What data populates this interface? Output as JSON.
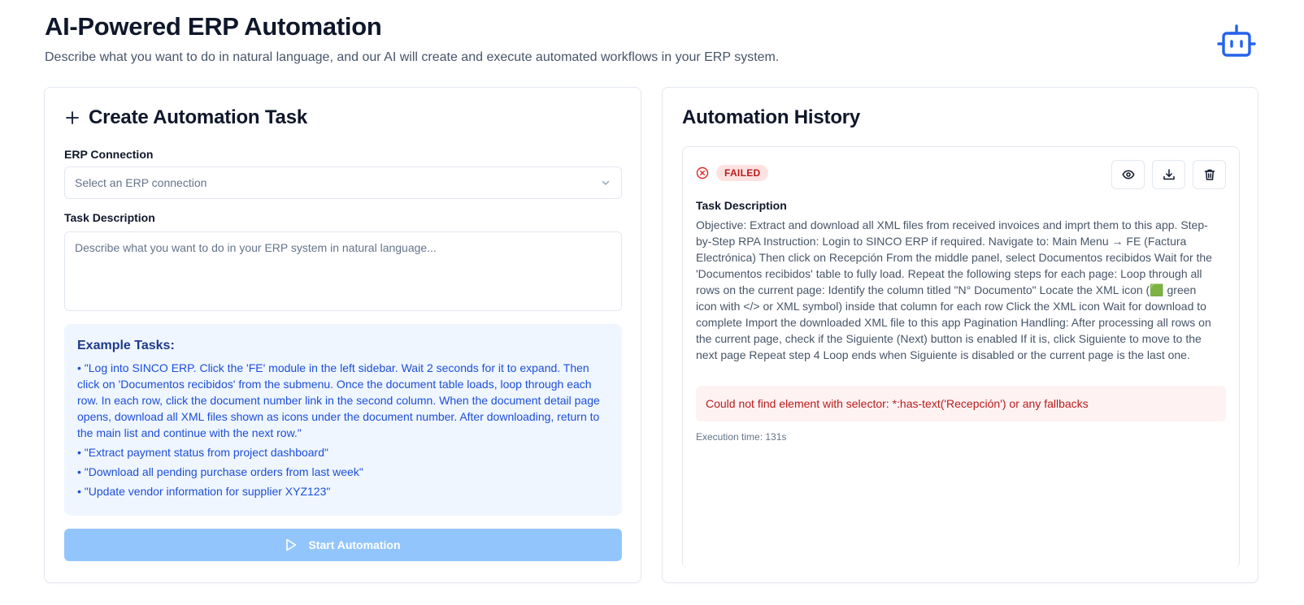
{
  "header": {
    "title": "AI-Powered ERP Automation",
    "subtitle": "Describe what you want to do in natural language, and our AI will create and execute automated workflows in your ERP system."
  },
  "create_task": {
    "title": "Create Automation Task",
    "erp_label": "ERP Connection",
    "erp_placeholder": "Select an ERP connection",
    "task_label": "Task Description",
    "task_placeholder": "Describe what you want to do in your ERP system in natural language...",
    "examples_title": "Example Tasks:",
    "examples": [
      "• \"Log into SINCO ERP. Click the 'FE' module in the left sidebar. Wait 2 seconds for it to expand. Then click on 'Documentos recibidos' from the submenu. Once the document table loads, loop through each row. In each row, click the document number link in the second column. When the document detail page opens, download all XML files shown as icons under the document number. After downloading, return to the main list and continue with the next row.\"",
      "• \"Extract payment status from project dashboard\"",
      "• \"Download all pending purchase orders from last week\"",
      "• \"Update vendor information for supplier XYZ123\""
    ],
    "start_button": "Start Automation"
  },
  "history": {
    "title": "Automation History",
    "items": [
      {
        "status": "FAILED",
        "task_label": "Task Description",
        "task_text": "Objective: Extract and download all XML files from received invoices and imprt them to this app. Step-by-Step RPA Instruction: Login to SINCO ERP if required. Navigate to: Main Menu → FE (Factura Electrónica) Then click on Recepción From the middle panel, select Documentos recibidos Wait for the 'Documentos recibidos' table to fully load. Repeat the following steps for each page: Loop through all rows on the current page: Identify the column titled \"N° Documento\" Locate the XML icon (🟩 green icon with </> or XML symbol) inside that column for each row Click the XML icon Wait for download to complete Import the downloaded XML file to this app Pagination Handling: After processing all rows on the current page, check if the Siguiente (Next) button is enabled If it is, click Siguiente to move to the next page Repeat step 4 Loop ends when Siguiente is disabled or the current page is the last one.",
        "error": "Could not find element with selector: *:has-text('Recepción') or any fallbacks",
        "execution_time": "Execution time: 131s"
      }
    ]
  },
  "colors": {
    "accent": "#2563eb",
    "button_disabled": "#93c5fd",
    "error": "#b91c1c",
    "example_bg": "#eff6ff"
  },
  "icons": [
    "bot-icon",
    "plus-icon",
    "chevron-down-icon",
    "x-circle-icon",
    "eye-icon",
    "download-icon",
    "trash-icon",
    "play-icon"
  ]
}
